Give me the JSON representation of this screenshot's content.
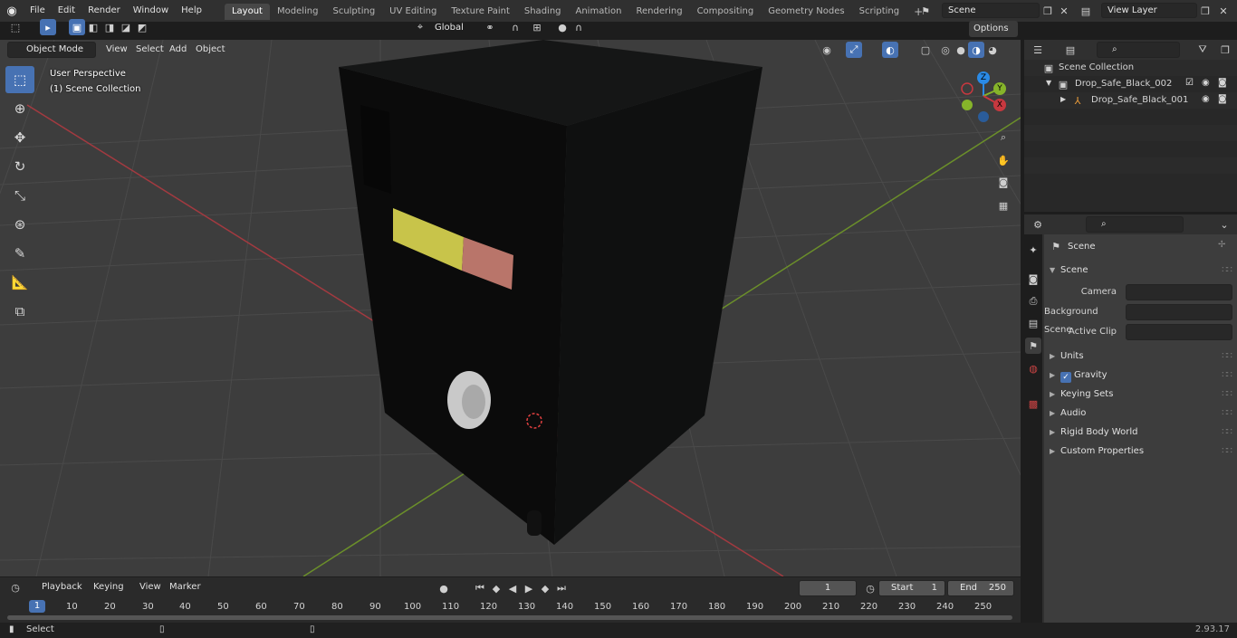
{
  "menus": [
    "File",
    "Edit",
    "Render",
    "Window",
    "Help"
  ],
  "workspaces": [
    "Layout",
    "Modeling",
    "Sculpting",
    "UV Editing",
    "Texture Paint",
    "Shading",
    "Animation",
    "Rendering",
    "Compositing",
    "Geometry Nodes",
    "Scripting"
  ],
  "active_workspace": "Layout",
  "add_workspace": "+",
  "scene_name": "Scene",
  "view_layer": "View Layer",
  "viewport": {
    "mode": "Object Mode",
    "menus": [
      "View",
      "Select",
      "Add",
      "Object"
    ],
    "transform_orientation": "Global",
    "options": "Options",
    "overlay_text_1": "User Perspective",
    "overlay_text_2": "(1) Scene Collection",
    "gizmo": {
      "z": "Z",
      "y": "Y",
      "x": "X"
    }
  },
  "outliner": {
    "root": "Scene Collection",
    "items": [
      {
        "label": "Drop_Safe_Black_002",
        "level": 1
      },
      {
        "label": "Drop_Safe_Black_001",
        "level": 2
      }
    ]
  },
  "properties": {
    "context": "Scene",
    "panel": "Scene",
    "fields": [
      {
        "label": "Camera",
        "value": ""
      },
      {
        "label": "Background Scene",
        "value": ""
      },
      {
        "label": "Active Clip",
        "value": ""
      }
    ],
    "subpanels": [
      "Units",
      "Gravity",
      "Keying Sets",
      "Audio",
      "Rigid Body World",
      "Custom Properties"
    ],
    "gravity_checked": true
  },
  "timeline": {
    "menus": [
      "Playback",
      "Keying",
      "View",
      "Marker"
    ],
    "current_frame": "1",
    "start_label": "Start",
    "start": "1",
    "end_label": "End",
    "end": "250",
    "ticks": [
      "1",
      "10",
      "20",
      "30",
      "40",
      "50",
      "60",
      "70",
      "80",
      "90",
      "100",
      "110",
      "120",
      "130",
      "140",
      "150",
      "160",
      "170",
      "180",
      "190",
      "200",
      "210",
      "220",
      "230",
      "240",
      "250"
    ]
  },
  "status": {
    "left": "Select",
    "version": "2.93.17"
  },
  "colors": {
    "accent": "#4772b3",
    "x_axis": "#c8383f",
    "y_axis": "#86b42a",
    "z_axis": "#2a8ae6",
    "grid": "#474747"
  }
}
